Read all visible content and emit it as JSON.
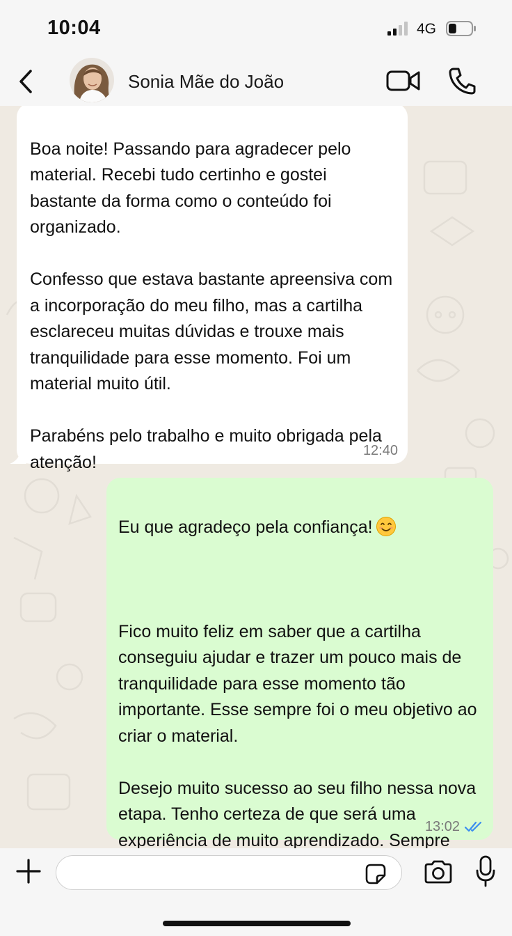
{
  "status_bar": {
    "time": "10:04",
    "network": "4G",
    "signal_bars": 2,
    "signal_bars_total": 4,
    "battery_level": 0.35
  },
  "header": {
    "contact_name": "Sonia Mãe do João",
    "back_icon": "chevron-left-icon",
    "video_icon": "video-camera-icon",
    "call_icon": "phone-icon"
  },
  "messages": [
    {
      "direction": "incoming",
      "text": "Boa noite! Passando para agradecer pelo material. Recebi tudo certinho e gostei bastante da forma como o conteúdo foi organizado.\n\nConfesso que estava bastante apreensiva com a incorporação do meu filho, mas a cartilha esclareceu muitas dúvidas e trouxe mais tranquilidade para esse momento. Foi um material muito útil.\n\nParabéns pelo trabalho e muito obrigada pela atenção!",
      "time": "12:40"
    },
    {
      "direction": "outgoing",
      "text_first_line": "Eu que agradeço pela confiança!",
      "emoji": "smiling-face-icon",
      "text": "Fico muito feliz em saber que a cartilha conseguiu ajudar e trazer um pouco mais de tranquilidade para esse momento tão importante. Esse sempre foi o meu objetivo ao criar o material.\n\nDesejo muito sucesso ao seu filho nessa nova etapa. Tenho certeza de que será uma experiência de muito aprendizado. Sempre que precisarem, estarei à disposição. Um grande abraço!",
      "time": "13:02",
      "status": "read"
    }
  ],
  "composer": {
    "input_value": "",
    "plus_icon": "plus-icon",
    "sticker_icon": "sticker-icon",
    "camera_icon": "camera-icon",
    "mic_icon": "microphone-icon"
  },
  "colors": {
    "incoming_bubble": "#ffffff",
    "outgoing_bubble": "#dafcd1",
    "read_ticks": "#3b8df0",
    "chat_background": "#efeae2"
  }
}
